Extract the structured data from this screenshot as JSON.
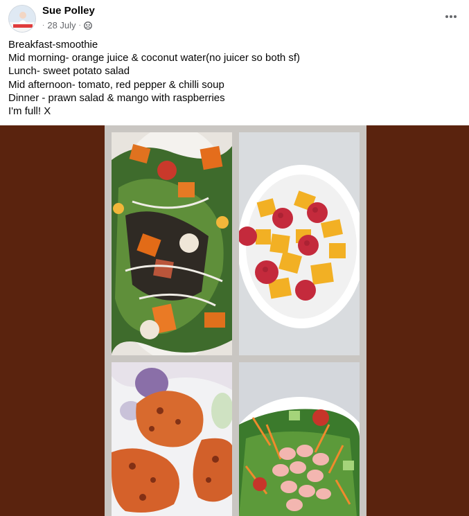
{
  "post": {
    "author": "Sue Polley",
    "date": "28 July",
    "separator": "·",
    "privacy_icon": "friends-icon",
    "more_icon": "more-icon",
    "lines": [
      "Breakfast-smoothie",
      "Mid morning- orange juice & coconut water(no juicer so both sf)",
      "Lunch- sweet potato salad",
      "Mid afternoon- tomato, red pepper & chilli soup",
      "Dinner - prawn salad & mango with raspberries",
      "I'm full! X"
    ]
  },
  "photos": [
    {
      "name": "sweet-potato-salad"
    },
    {
      "name": "mango-raspberries-bowl"
    },
    {
      "name": "sweet-potato-fritters"
    },
    {
      "name": "prawn-salad"
    }
  ],
  "colors": {
    "photo_background": "#5a230e",
    "name_text": "#050505",
    "meta_text": "#65676b"
  }
}
